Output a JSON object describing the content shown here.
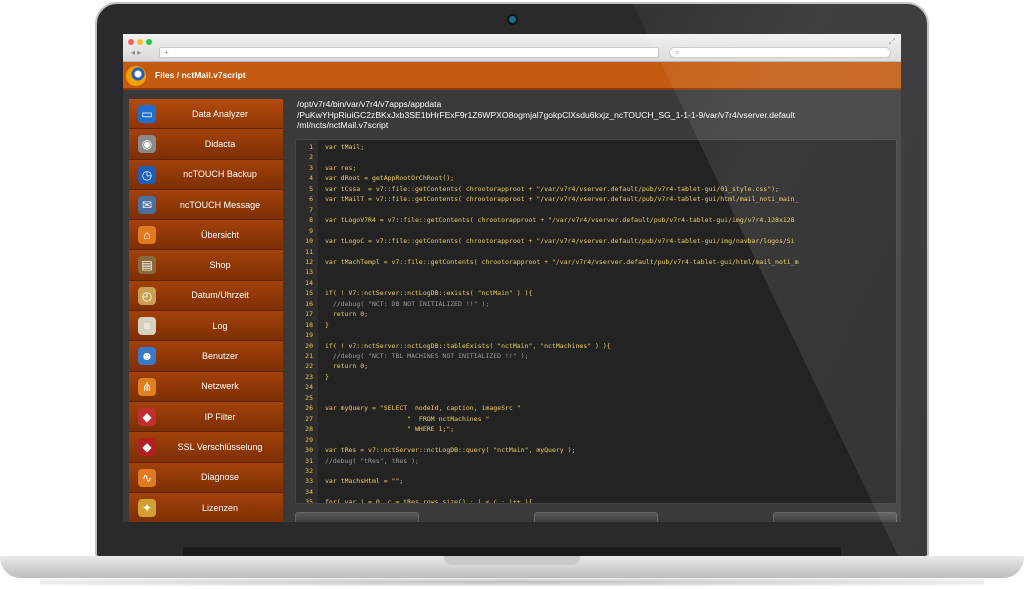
{
  "header": {
    "title": "Files / nctMail.v7script"
  },
  "browser": {
    "url_placeholder": "+"
  },
  "sidebar": {
    "items": [
      {
        "label": "Data Analyzer",
        "icon": "monitor-icon",
        "color": "#1f6fd0",
        "glyph": "▭"
      },
      {
        "label": "Didacta",
        "icon": "camera-icon",
        "color": "#8a8a8a",
        "glyph": "◉"
      },
      {
        "label": "ncTOUCH Backup",
        "icon": "clock-icon",
        "color": "#1e5fb8",
        "glyph": "◷"
      },
      {
        "label": "ncTOUCH Message",
        "icon": "envelope-icon",
        "color": "#4a6fa0",
        "glyph": "✉"
      },
      {
        "label": "Übersicht",
        "icon": "house-icon",
        "color": "#e07a20",
        "glyph": "⌂"
      },
      {
        "label": "Shop",
        "icon": "basket-icon",
        "color": "#8a6a3a",
        "glyph": "▤"
      },
      {
        "label": "Datum/Uhrzeit",
        "icon": "clock-time-icon",
        "color": "#c9a050",
        "glyph": "◴"
      },
      {
        "label": "Log",
        "icon": "document-icon",
        "color": "#d8d0c0",
        "glyph": "≡"
      },
      {
        "label": "Benutzer",
        "icon": "user-icon",
        "color": "#3a78c8",
        "glyph": "☻"
      },
      {
        "label": "Netzwerk",
        "icon": "network-icon",
        "color": "#e08020",
        "glyph": "⋔"
      },
      {
        "label": "IP Filter",
        "icon": "shield-icon",
        "color": "#c03030",
        "glyph": "◆"
      },
      {
        "label": "SSL Verschlüsselung",
        "icon": "ssl-shield-icon",
        "color": "#b02020",
        "glyph": "◆"
      },
      {
        "label": "Diagnose",
        "icon": "pulse-icon",
        "color": "#e07a20",
        "glyph": "∿"
      },
      {
        "label": "Lizenzen",
        "icon": "license-icon",
        "color": "#d0a030",
        "glyph": "✦"
      }
    ]
  },
  "path": {
    "line1": "/opt/v7r4/bin/var/v7r4/v7apps/appdata",
    "line2": "/PuKwYHpRiuiGC2zBKxJxb3SE1bHrFExF9r1Z6WPXO8ogmjal7gokpClXsdu6kxjz_ncTOUCH_SG_1-1-1-9/var/v7r4/vserver.default",
    "line3": "/ml/ncts/nctMail.v7script"
  },
  "code": {
    "lines": [
      {
        "n": "1",
        "text": "var tMail;"
      },
      {
        "n": "2",
        "text": ""
      },
      {
        "n": "3",
        "text": "var res;"
      },
      {
        "n": "4",
        "text": "var dRoot = getAppRootOrChRoot();"
      },
      {
        "n": "5",
        "text": "var tCssa  = v7::file::getContents( chrootorapproot + \"/var/v7r4/vserver.default/pub/v7r4-tablet-gui/01_style.css\");"
      },
      {
        "n": "6",
        "text": "var tMailT = v7::file::getContents( chrootorapproot + \"/var/v7r4/vserver.default/pub/v7r4-tablet-gui/html/mail_noti_main_"
      },
      {
        "n": "7",
        "text": ""
      },
      {
        "n": "8",
        "text": "var tLogoV7R4 = v7::file::getContents( chrootorapproot + \"/var/v7r4/vserver.default/pub/v7r4-tablet-gui/img/v7r4.128x128"
      },
      {
        "n": "9",
        "text": ""
      },
      {
        "n": "10",
        "text": "var tLogoC = v7::file::getContents( chrootorapproot + \"/var/v7r4/vserver.default/pub/v7r4-tablet-gui/img/navbar/logos/Si"
      },
      {
        "n": "11",
        "text": ""
      },
      {
        "n": "12",
        "text": "var tMachTempl = v7::file::getContents( chrootorapproot + \"/var/v7r4/vserver.default/pub/v7r4-tablet-gui/html/mail_noti_m"
      },
      {
        "n": "13",
        "text": ""
      },
      {
        "n": "14",
        "text": ""
      },
      {
        "n": "15",
        "text": "if( ! V7::nctServer::nctLogDB::exists( \"nctMain\" ) ){"
      },
      {
        "n": "16",
        "text": "  //debug( \"NCT: DB NOT INITIALIZED !!\" );"
      },
      {
        "n": "17",
        "text": "  return 0;"
      },
      {
        "n": "18",
        "text": "}"
      },
      {
        "n": "19",
        "text": ""
      },
      {
        "n": "20",
        "text": "if( ! v7::nctServer::nctLogDB::tableExists( \"nctMain\", \"nctMachines\" ) ){"
      },
      {
        "n": "21",
        "text": "  //debug( \"NCT: TBL MACHINES NOT INITIALIZED !!\" );"
      },
      {
        "n": "22",
        "text": "  return 0;"
      },
      {
        "n": "23",
        "text": "}"
      },
      {
        "n": "24",
        "text": ""
      },
      {
        "n": "25",
        "text": ""
      },
      {
        "n": "26",
        "text": "var myQuery = \"SELECT  nodeId, caption, imageSrc \""
      },
      {
        "n": "27",
        "text": "                     \"  FROM nctMachines \""
      },
      {
        "n": "28",
        "text": "                     \" WHERE 1;\";"
      },
      {
        "n": "29",
        "text": ""
      },
      {
        "n": "30",
        "text": "var tRes = v7::nctServer::nctLogDB::query( \"nctMain\", myQuery );"
      },
      {
        "n": "31",
        "text": "//debug( \"tRes\", tRes );"
      },
      {
        "n": "32",
        "text": ""
      },
      {
        "n": "33",
        "text": "var tMachsHtml = \"\";"
      },
      {
        "n": "34",
        "text": ""
      },
      {
        "n": "35",
        "text": "for( var i = 0, c = tRes.rows.size() ; i < c ; i++ ){"
      }
    ]
  },
  "colors": {
    "accent": "#c35b10",
    "sidebar": "#8e3606",
    "code_text": "#f0d060",
    "line_number": "#f3c640",
    "comment": "#9a9a9a"
  }
}
